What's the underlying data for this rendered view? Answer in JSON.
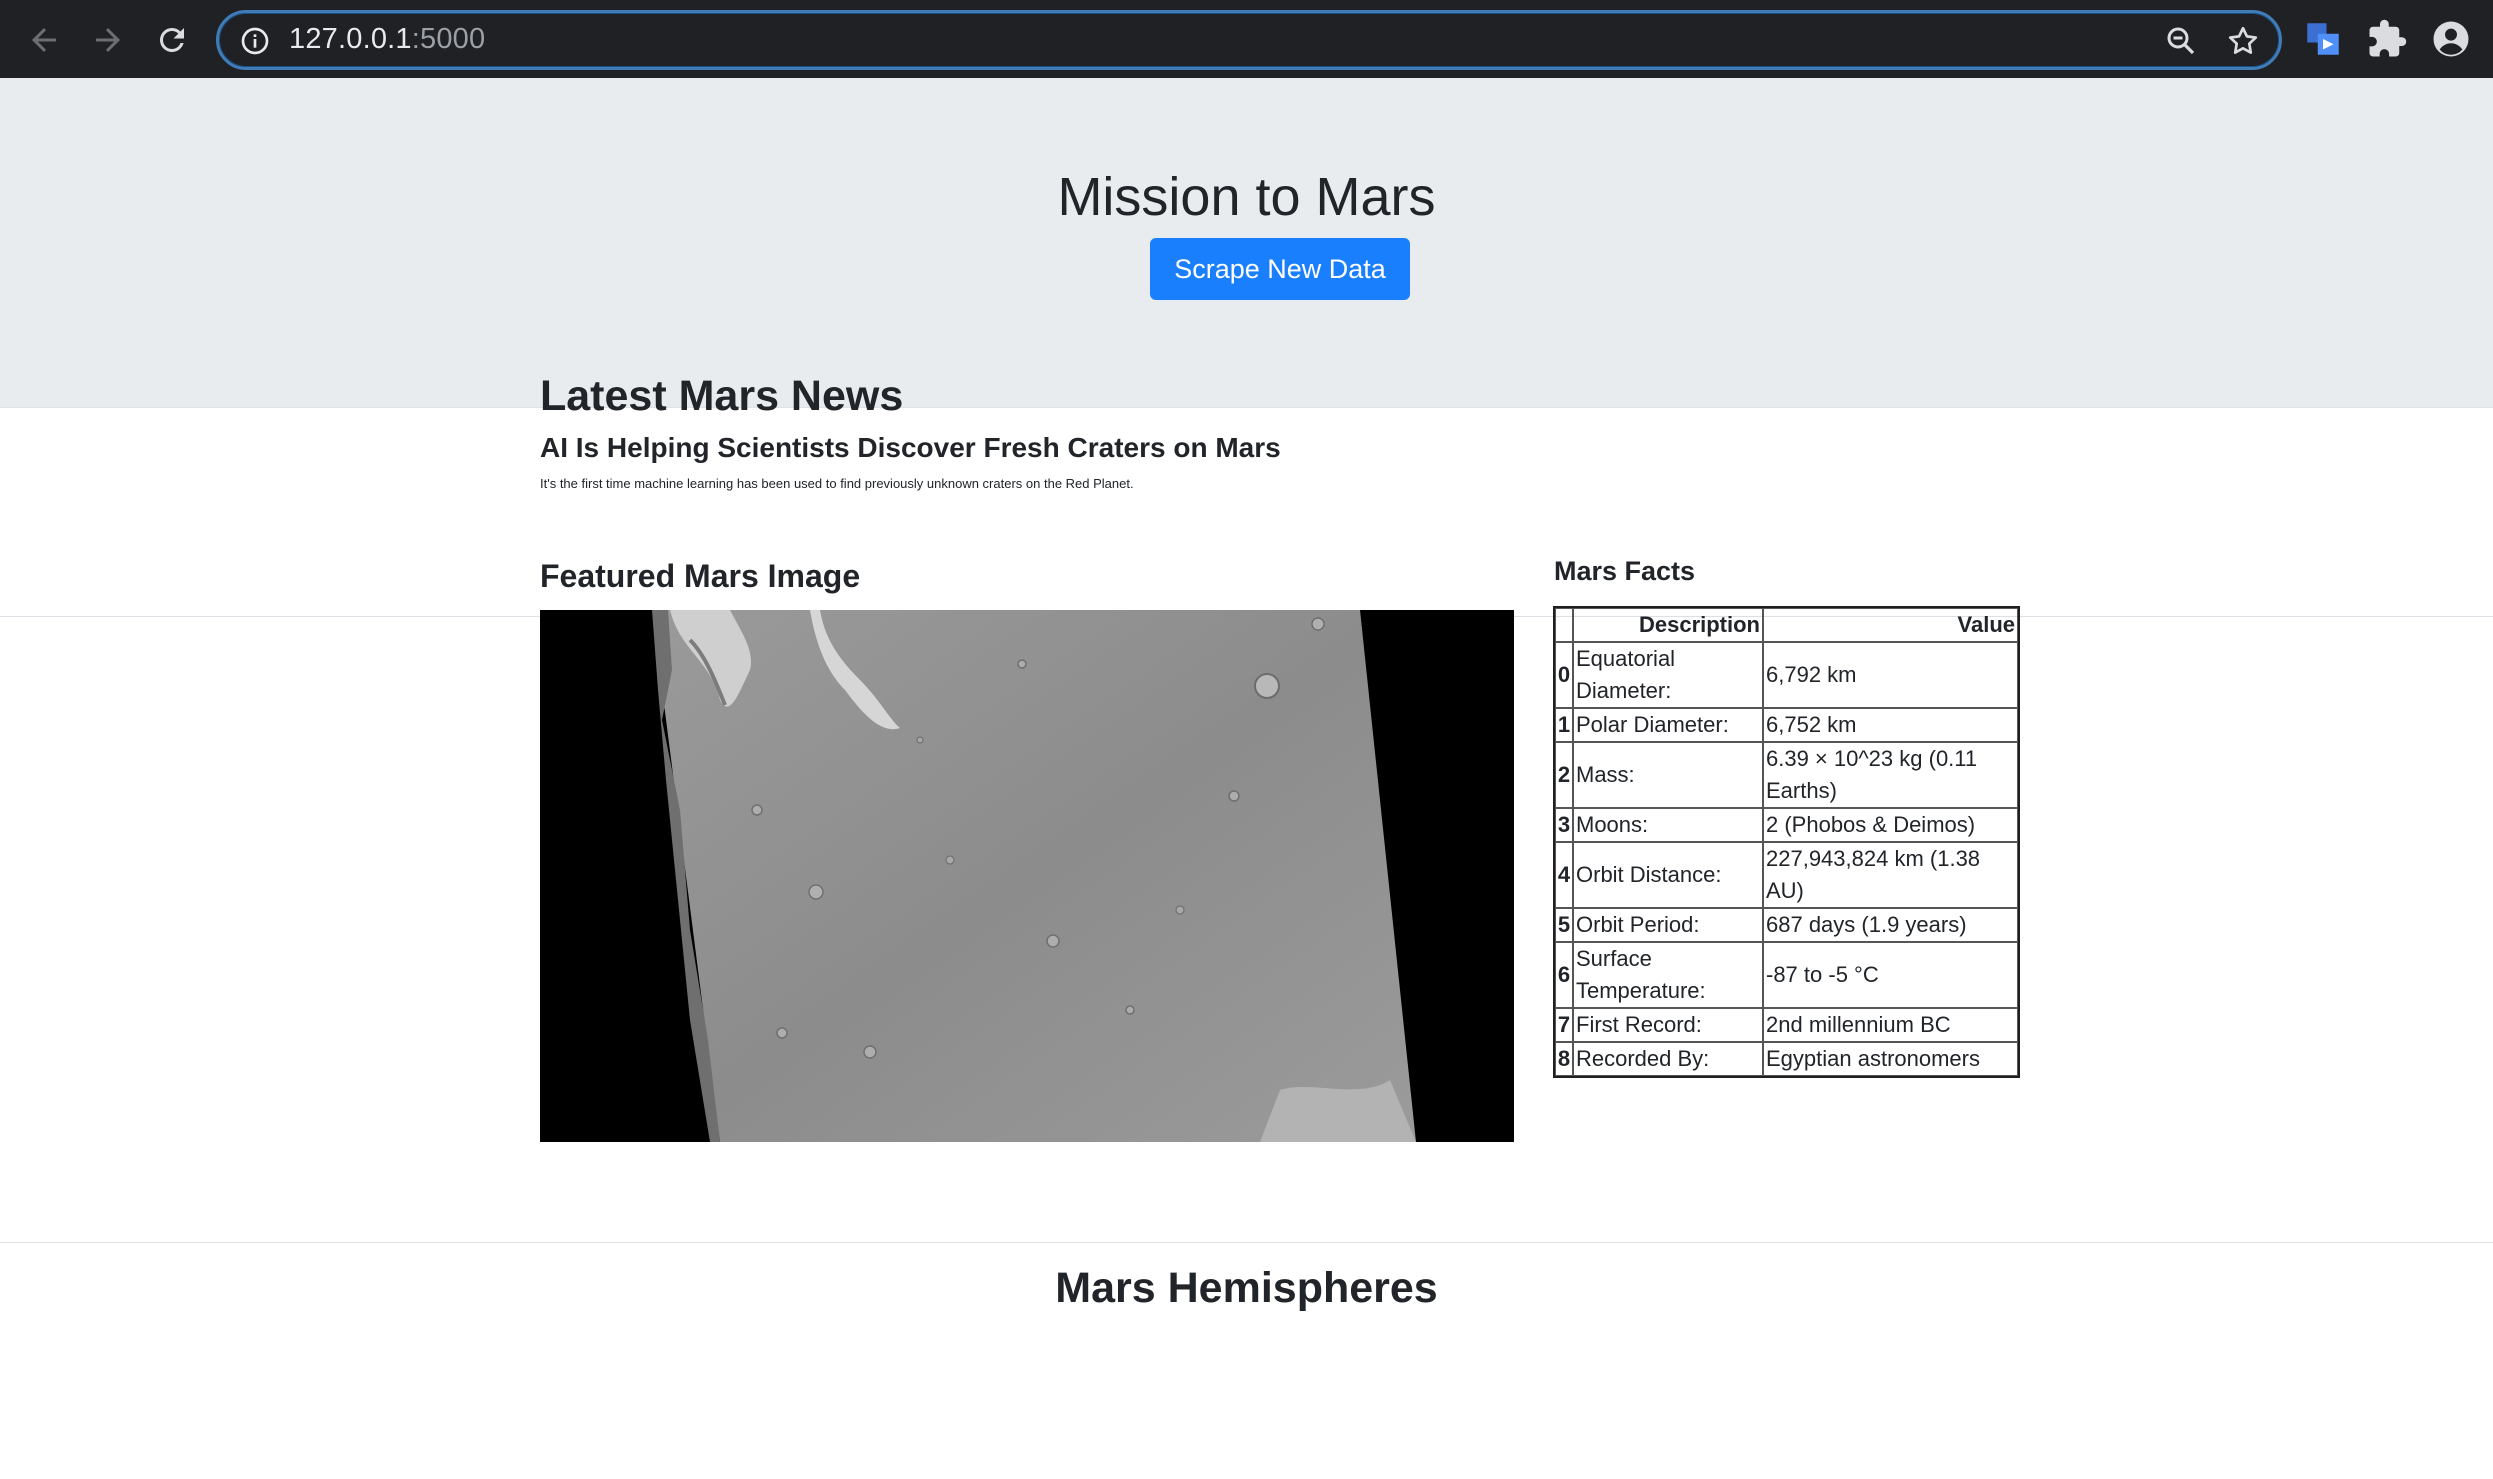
{
  "browser": {
    "url_host": "127.0.0.1",
    "url_port": ":5000",
    "icons": [
      "back-arrow-icon",
      "forward-arrow-icon",
      "reload-icon",
      "info-icon",
      "zoom-icon",
      "star-icon",
      "extension-icon",
      "puzzle-icon",
      "profile-icon"
    ]
  },
  "header": {
    "title": "Mission to Mars",
    "scrape_button": "Scrape New Data",
    "button_color": "#1a7ffc",
    "background": "#e9ecef"
  },
  "news": {
    "heading": "Latest Mars News",
    "title": "AI Is Helping Scientists Discover Fresh Craters on Mars",
    "teaser": "It's the first time machine learning has been used to find previously unknown craters on the Red Planet."
  },
  "featured": {
    "heading": "Featured Mars Image"
  },
  "facts": {
    "heading": "Mars Facts",
    "columns": [
      "Description",
      "Value"
    ],
    "rows": [
      {
        "index": "0",
        "description": "Equatorial Diameter:",
        "value": "6,792 km"
      },
      {
        "index": "1",
        "description": "Polar Diameter:",
        "value": "6,752 km"
      },
      {
        "index": "2",
        "description": "Mass:",
        "value": "6.39 × 10^23 kg (0.11 Earths)"
      },
      {
        "index": "3",
        "description": "Moons:",
        "value": "2 (Phobos & Deimos)"
      },
      {
        "index": "4",
        "description": "Orbit Distance:",
        "value": "227,943,824 km (1.38 AU)"
      },
      {
        "index": "5",
        "description": "Orbit Period:",
        "value": "687 days (1.9 years)"
      },
      {
        "index": "6",
        "description": "Surface Temperature:",
        "value": "-87 to -5 °C"
      },
      {
        "index": "7",
        "description": "First Record:",
        "value": "2nd millennium BC"
      },
      {
        "index": "8",
        "description": "Recorded By:",
        "value": "Egyptian astronomers"
      }
    ]
  },
  "hemispheres": {
    "heading": "Mars Hemispheres"
  }
}
